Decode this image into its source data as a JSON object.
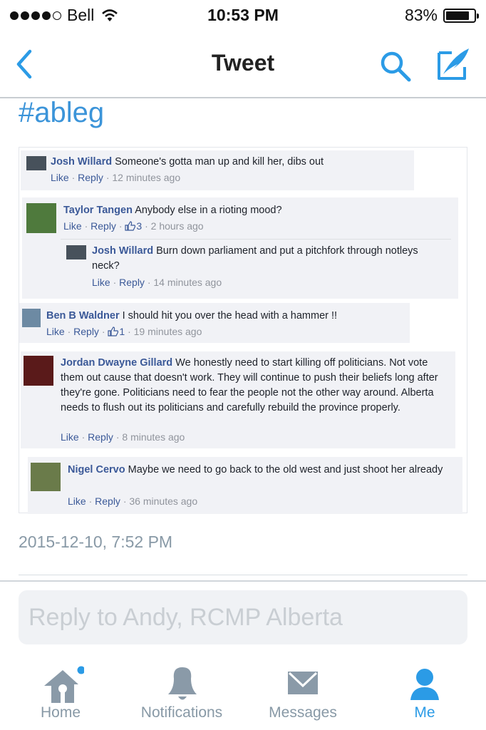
{
  "status_bar": {
    "carrier": "Bell",
    "time": "10:53 PM",
    "battery": "83%",
    "battery_level": 0.83
  },
  "nav": {
    "title": "Tweet"
  },
  "tweet": {
    "hashtag": "#ableg",
    "timestamp": "2015-12-10, 7:52 PM",
    "screenshot_comments": [
      {
        "author": "Josh Willard",
        "text": "Someone's gotta man up and kill her, dibs out",
        "like": "Like",
        "reply": "Reply",
        "likes": "",
        "time": "12 minutes ago"
      },
      {
        "author": "Taylor Tangen",
        "text": "Anybody else in a rioting mood?",
        "like": "Like",
        "reply": "Reply",
        "likes": "3",
        "time": "2 hours ago"
      },
      {
        "author": "Josh Willard",
        "text": "Burn down parliament and put a pitchfork through notleys neck?",
        "like": "Like",
        "reply": "Reply",
        "likes": "",
        "time": "14 minutes ago"
      },
      {
        "author": "Ben B Waldner",
        "text": "I should hit you over the head with a hammer !!",
        "like": "Like",
        "reply": "Reply",
        "likes": "1",
        "time": "19 minutes ago"
      },
      {
        "author": "Jordan Dwayne Gillard",
        "text": "We honestly need to start killing off politicians. Not vote them out cause that doesn't work. They will continue to push their beliefs long after they're gone. Politicians need to fear the people not the other way around. Alberta needs to flush out its politicians and carefully rebuild the province properly.",
        "like": "Like",
        "reply": "Reply",
        "likes": "",
        "time": "8 minutes ago"
      },
      {
        "author": "Nigel Cervo",
        "text": "Maybe we need to go back to the old west and just shoot her already",
        "like": "Like",
        "reply": "Reply",
        "likes": "",
        "time": "36 minutes ago"
      }
    ]
  },
  "reply_box": {
    "placeholder": "Reply to Andy, RCMP Alberta"
  },
  "tab_bar": {
    "tabs": [
      {
        "label": "Home",
        "icon": "home-icon",
        "active": false,
        "has_notification_dot": true
      },
      {
        "label": "Notifications",
        "icon": "bell-icon",
        "active": false
      },
      {
        "label": "Messages",
        "icon": "envelope-icon",
        "active": false
      },
      {
        "label": "Me",
        "icon": "person-icon",
        "active": true
      }
    ]
  },
  "colors": {
    "accent": "#2b9be6",
    "hashtag": "#3b94d9",
    "fb_link": "#3b5998",
    "muted": "#8899a6"
  }
}
